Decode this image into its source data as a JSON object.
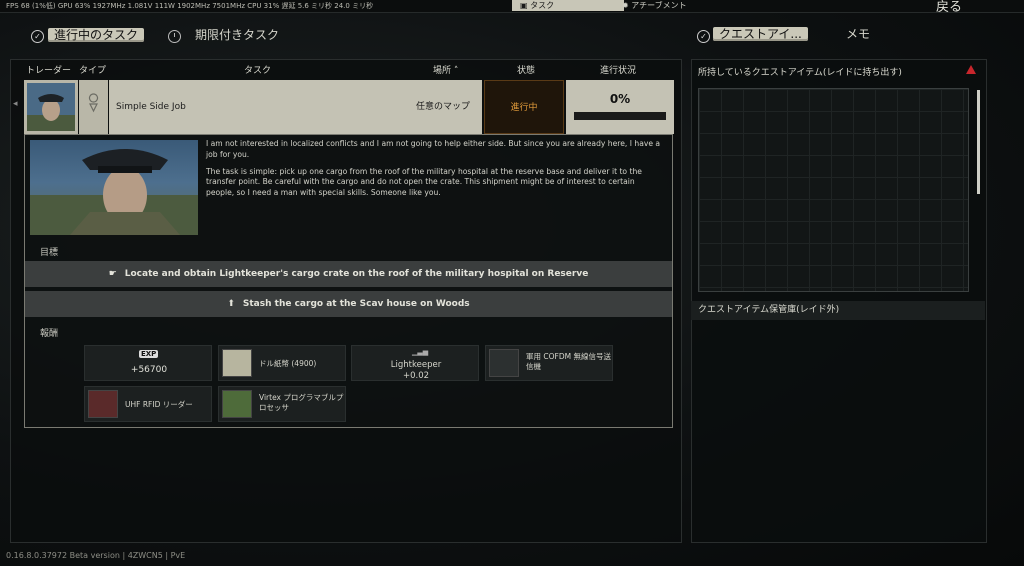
{
  "topbar": {
    "perf": "FPS 68 (1%低) GPU 63% 1927MHz 1.081V 111W 1902MHz 7501MHz CPU 31% 遅延 5.6 ミリ秒 24.0 ミリ秒",
    "tabs": [
      {
        "label": "タスク",
        "active": true
      },
      {
        "label": "アチーブメント",
        "active": false
      }
    ],
    "back_label": "戻る"
  },
  "left": {
    "subtabs": [
      {
        "label": "進行中のタスク",
        "active": true
      },
      {
        "label": "期限付きタスク",
        "active": false
      }
    ],
    "columns": {
      "trader": "トレーダー",
      "type": "タイプ",
      "task": "タスク",
      "location": "場所",
      "status": "状態",
      "progress": "進行状況"
    },
    "task": {
      "name": "Simple Side Job",
      "location": "任意のマップ",
      "status": "進行中",
      "progress_text": "0%",
      "progress": 0,
      "description": [
        "I am not interested in localized conflicts and I am not going to help either side. But since you are already here, I have a job for you.",
        "The task is simple: pick up one cargo from the roof of the military hospital at the reserve base and deliver it to the transfer point. Be careful with the cargo and do not open the crate. This shipment might be of interest to certain people, so I need a man with special skills. Someone like you."
      ],
      "objectives_title": "目標",
      "objectives": [
        {
          "icon": "hand-icon",
          "text": "Locate and obtain Lightkeeper's cargo crate on the roof of the military hospital on Reserve"
        },
        {
          "icon": "arrow-up-icon",
          "text": "Stash the cargo at the Scav house on Woods"
        }
      ],
      "rewards_title": "報酬",
      "rewards": [
        {
          "name": "EXP",
          "value": "+56700"
        },
        {
          "name": "ドル紙幣 (4900)"
        },
        {
          "name": "Lightkeeper",
          "value": "+0.02"
        },
        {
          "name": "軍用 COFDM 無線信号送信機"
        },
        {
          "name": "UHF RFID リーダー"
        },
        {
          "name": "Virtex プログラマブルプロセッサ"
        }
      ]
    }
  },
  "right": {
    "subtabs": [
      {
        "label": "クエストアイ...",
        "active": true
      },
      {
        "label": "メモ",
        "active": false
      }
    ],
    "quest_items_title": "所持しているクエストアイテム(レイドに持ち出す)",
    "stash_title": "クエストアイテム保管庫(レイド外)"
  },
  "footer": {
    "version": "0.16.8.0.37972 Beta version | 4ZWCN5 | PvE"
  },
  "colors": {
    "accent_pill": "#cac8b8",
    "status_orange": "#e09a3a",
    "warning_red": "#c8262c"
  }
}
